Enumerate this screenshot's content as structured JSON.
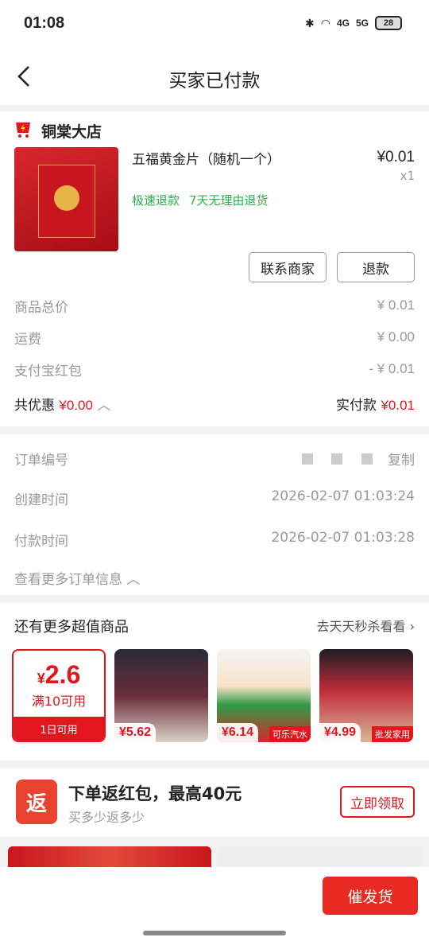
{
  "status": {
    "time": "01:08",
    "net1": "4G",
    "net2": "5G",
    "battery": "28"
  },
  "nav": {
    "title": "买家已付款"
  },
  "store": {
    "name": "铜棠大店",
    "product": {
      "title": "五福黄金片（随机一个）",
      "price": "¥0.01",
      "qty": "x1",
      "tags": [
        "极速退款",
        "7天无理由退货"
      ]
    },
    "buttons": {
      "contact": "联系商家",
      "refund": "退款"
    },
    "summary": [
      {
        "label": "商品总价",
        "value": "¥ 0.01"
      },
      {
        "label": "运费",
        "value": "¥ 0.00"
      },
      {
        "label": "支付宝红包",
        "value": "- ¥ 0.01"
      }
    ],
    "discount_label": "共优惠",
    "discount_value": "¥0.00",
    "paid_label": "实付款",
    "paid_value": "¥0.01"
  },
  "order": {
    "number_label": "订单编号",
    "copy_label": "复制",
    "created_label": "创建时间",
    "created_value": "2026-02-07 01:03:24",
    "paid_label": "付款时间",
    "paid_value": "2026-02-07 01:03:28",
    "more": "查看更多订单信息"
  },
  "deals": {
    "title": "还有更多超值商品",
    "link": "去天天秒杀看看",
    "coupon": {
      "amount": "2.6",
      "currency": "¥",
      "condition": "满10可用",
      "footer": "1日可用"
    },
    "items": [
      {
        "price": "¥5.62",
        "label": ""
      },
      {
        "price": "¥6.14",
        "label": "可乐汽水"
      },
      {
        "price": "¥4.99",
        "label": "批发家用"
      }
    ]
  },
  "redpacket": {
    "icon": "返",
    "title": "下单返红包，最高40元",
    "subtitle": "买多少返多少",
    "button": "立即领取"
  },
  "bottom": {
    "urge": "催发货"
  }
}
